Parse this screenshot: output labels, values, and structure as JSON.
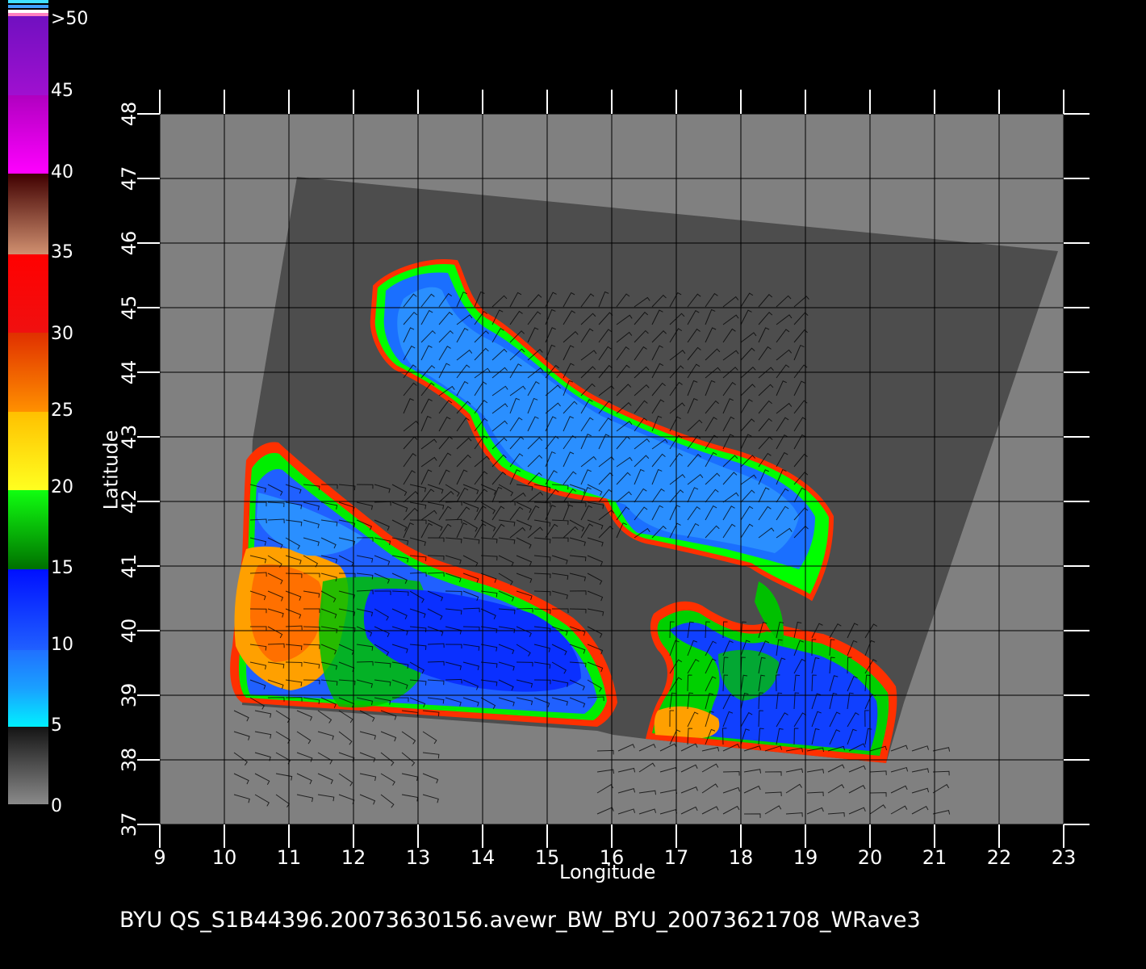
{
  "colorbar": {
    "labels": [
      "0",
      "5",
      "10",
      "15",
      "20",
      "25",
      "30",
      "35",
      "40",
      "45",
      ">50"
    ]
  },
  "map": {
    "xlabel": "Longitude",
    "ylabel": "Latitude",
    "lon_ticks": [
      "9",
      "10",
      "11",
      "12",
      "13",
      "14",
      "15",
      "16",
      "17",
      "18",
      "19",
      "20",
      "21",
      "22",
      "23"
    ],
    "lat_ticks": [
      "37",
      "38",
      "39",
      "40",
      "41",
      "42",
      "43",
      "44",
      "45",
      "46",
      "47",
      "48"
    ],
    "lon_range": [
      9,
      23
    ],
    "lat_range": [
      37,
      48
    ],
    "colors": {
      "land": "#808080",
      "swath": "#4d4d4d",
      "grid": "#000000"
    }
  },
  "caption": "BYU  QS_S1B44396.20073630156.avewr_BW_BYU_20073621708_WRave3"
}
